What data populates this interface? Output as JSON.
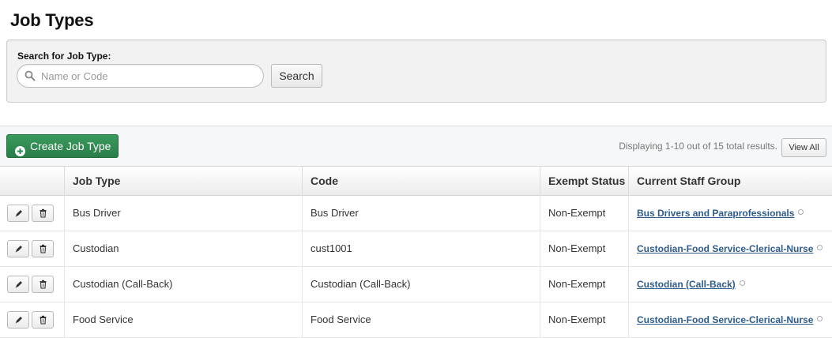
{
  "page": {
    "title": "Job Types"
  },
  "search": {
    "label": "Search for Job Type:",
    "placeholder": "Name or Code",
    "value": "",
    "button_label": "Search"
  },
  "toolbar": {
    "create_label": "Create Job Type",
    "results_text": "Displaying 1-10 out of 15 total results.",
    "view_all_label": "View All"
  },
  "table": {
    "columns": [
      "",
      "Job Type",
      "Code",
      "Exempt Status",
      "Current Staff Group"
    ],
    "rows": [
      {
        "job_type": "Bus Driver",
        "code": "Bus Driver",
        "exempt": "Non-Exempt",
        "group": "Bus Drivers and Paraprofessionals"
      },
      {
        "job_type": "Custodian",
        "code": "cust1001",
        "exempt": "Non-Exempt",
        "group": "Custodian-Food Service-Clerical-Nurse"
      },
      {
        "job_type": "Custodian (Call-Back)",
        "code": "Custodian (Call-Back)",
        "exempt": "Non-Exempt",
        "group": "Custodian (Call-Back)"
      },
      {
        "job_type": "Food Service",
        "code": "Food Service",
        "exempt": "Non-Exempt",
        "group": "Custodian-Food Service-Clerical-Nurse"
      }
    ]
  },
  "icons": {
    "search": "search-icon",
    "create": "plus-circle-icon",
    "edit": "pencil-icon",
    "delete": "trash-icon",
    "group_status": "circle-outline-icon"
  },
  "colors": {
    "primary_button": "#2e8b52",
    "link": "#2d5b8c"
  }
}
